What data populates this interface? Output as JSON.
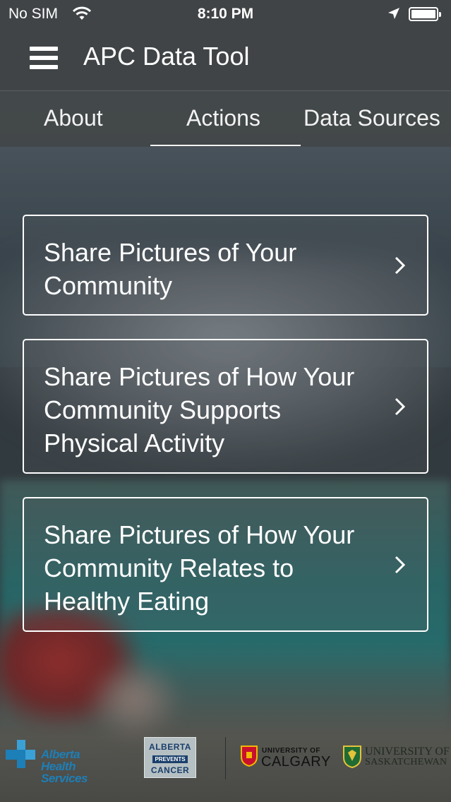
{
  "status_bar": {
    "carrier": "No SIM",
    "time": "8:10 PM",
    "icons": [
      "wifi-icon",
      "location-arrow-icon",
      "battery-icon"
    ]
  },
  "header": {
    "title": "APC Data Tool",
    "menu_icon": "hamburger-menu-icon"
  },
  "tabs": {
    "items": [
      {
        "label": "About"
      },
      {
        "label": "Actions"
      },
      {
        "label": "Data Sources"
      }
    ],
    "selected": "Actions"
  },
  "actions": {
    "items": [
      {
        "label": "Share Pictures of Your Community"
      },
      {
        "label": "Share Pictures of How Your Community Supports Physical Activity"
      },
      {
        "label": "Share Pictures of How Your Community Relates to Healthy Eating"
      }
    ],
    "chevron_icon": "chevron-right-icon"
  },
  "footer": {
    "logos": {
      "ahs": {
        "line1": "Alberta Health",
        "line2": "Services"
      },
      "apc": {
        "line1": "ALBERTA",
        "line2": "PREVENTS",
        "line3": "CANCER"
      },
      "ucalgary": {
        "line1": "UNIVERSITY OF",
        "line2": "CALGARY"
      },
      "usask": {
        "line1": "UNIVERSITY OF",
        "line2": "SASKATCHEWAN"
      }
    }
  },
  "colors": {
    "bar_background": "#404446",
    "ahs_blue": "#1d7fb7",
    "apc_navy": "#1a3f6b"
  }
}
